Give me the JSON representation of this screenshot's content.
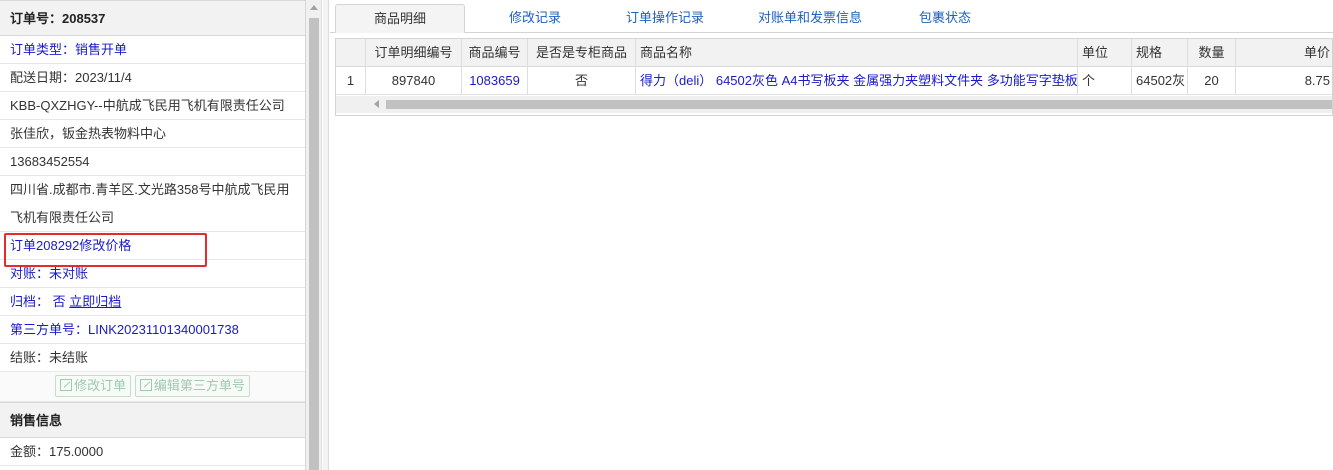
{
  "order": {
    "title": "订单号：208537",
    "type_label": "订单类型：",
    "type_value": "销售开单",
    "delivery_date": "配送日期：2023/11/4",
    "customer": "KBB-QXZHGY--中航成飞民用飞机有限责任公司",
    "contact": "张佳欣，钣金热表物料中心",
    "phone": "13683452554",
    "address_line1": "四川省.成都市.青羊区.文光路358号中航成飞民用",
    "address_line2": "飞机有限责任公司",
    "modify_note": "订单208292修改价格",
    "reconcile": "对账：未对账",
    "archive_label": "归档：",
    "archive_value": "否",
    "archive_link": "立即归档",
    "third_party": "第三方单号：LINK20231101340001738",
    "settlement": "结账：未结账",
    "btn_modify": "修改订单",
    "btn_edit_third": "编辑第三方单号"
  },
  "sales": {
    "title": "销售信息",
    "amount": "金额：175.0000"
  },
  "tabs": [
    "商品明细",
    "修改记录",
    "订单操作记录",
    "对账单和发票信息",
    "包裹状态"
  ],
  "grid": {
    "headers": [
      "",
      "订单明细编号",
      "商品编号",
      "是否是专柜商品",
      "商品名称",
      "单位",
      "规格",
      "数量",
      "单价"
    ],
    "rows": [
      [
        "1",
        "897840",
        "1083659",
        "否",
        "得力（deli） 64502灰色 A4书写板夹 金属强力夹塑料文件夹 多功能写字垫板",
        "个",
        "64502灰",
        "20",
        "8.75"
      ]
    ]
  },
  "colors": {
    "link_blue": "#1a1ac8",
    "highlight_red": "#e52b2b"
  }
}
